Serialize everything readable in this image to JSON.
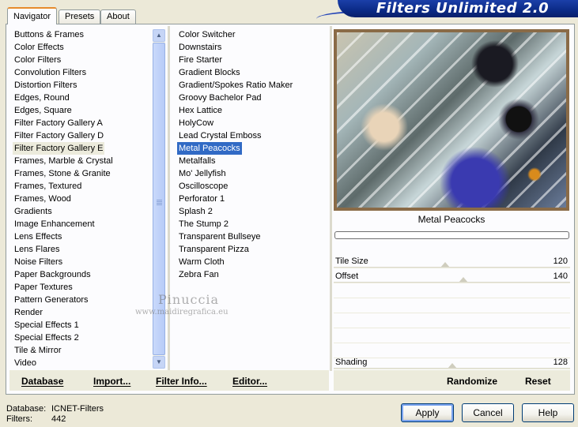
{
  "header": {
    "title": "Filters Unlimited 2.0"
  },
  "tabs": [
    {
      "label": "Navigator",
      "active": true
    },
    {
      "label": "Presets",
      "active": false
    },
    {
      "label": "About",
      "active": false
    }
  ],
  "categories": {
    "items": [
      "Buttons & Frames",
      "Color Effects",
      "Color Filters",
      "Convolution Filters",
      "Distortion Filters",
      "Edges, Round",
      "Edges, Square",
      "Filter Factory Gallery A",
      "Filter Factory Gallery D",
      "Filter Factory Gallery E",
      "Frames, Marble & Crystal",
      "Frames, Stone & Granite",
      "Frames, Textured",
      "Frames, Wood",
      "Gradients",
      "Image Enhancement",
      "Lens Effects",
      "Lens Flares",
      "Noise Filters",
      "Paper Backgrounds",
      "Paper Textures",
      "Pattern Generators",
      "Render",
      "Special Effects 1",
      "Special Effects 2",
      "Tile & Mirror",
      "Video"
    ],
    "selected": "Filter Factory Gallery E"
  },
  "filters": {
    "items": [
      "Color Switcher",
      "Downstairs",
      "Fire Starter",
      "Gradient Blocks",
      "Gradient/Spokes Ratio Maker",
      "Groovy Bachelor Pad",
      "Hex Lattice",
      "HolyCow",
      "Lead Crystal Emboss",
      "Metal Peacocks",
      "Metalfalls",
      "Mo' Jellyfish",
      "Oscilloscope",
      "Perforator 1",
      "Splash 2",
      "The Stump 2",
      "Transparent Bullseye",
      "Transparent Pizza",
      "Warm Cloth",
      "Zebra Fan"
    ],
    "selected": "Metal Peacocks"
  },
  "preview": {
    "filter_name": "Metal Peacocks",
    "progress": 0
  },
  "params": [
    {
      "label": "Tile Size",
      "value": "120",
      "level": 0.47
    },
    {
      "label": "Offset",
      "value": "140",
      "level": 0.55
    },
    {
      "label": "Shading",
      "value": "128",
      "level": 0.5
    }
  ],
  "bottom_links": {
    "database": "Database",
    "import": "Import...",
    "filter_info": "Filter Info...",
    "editor": "Editor...",
    "randomize": "Randomize",
    "reset": "Reset"
  },
  "status": {
    "database_label": "Database:",
    "database_value": "ICNET-Filters",
    "filters_label": "Filters:",
    "filters_value": "442"
  },
  "buttons": {
    "apply": "Apply",
    "cancel": "Cancel",
    "help": "Help"
  },
  "watermark": {
    "line1": "Pinuccia",
    "line2": "www.maidiregrafica.eu"
  },
  "colors": {
    "banner": "#0b2a86",
    "selection": "#316ac5",
    "progress": "#3c9a3c"
  }
}
